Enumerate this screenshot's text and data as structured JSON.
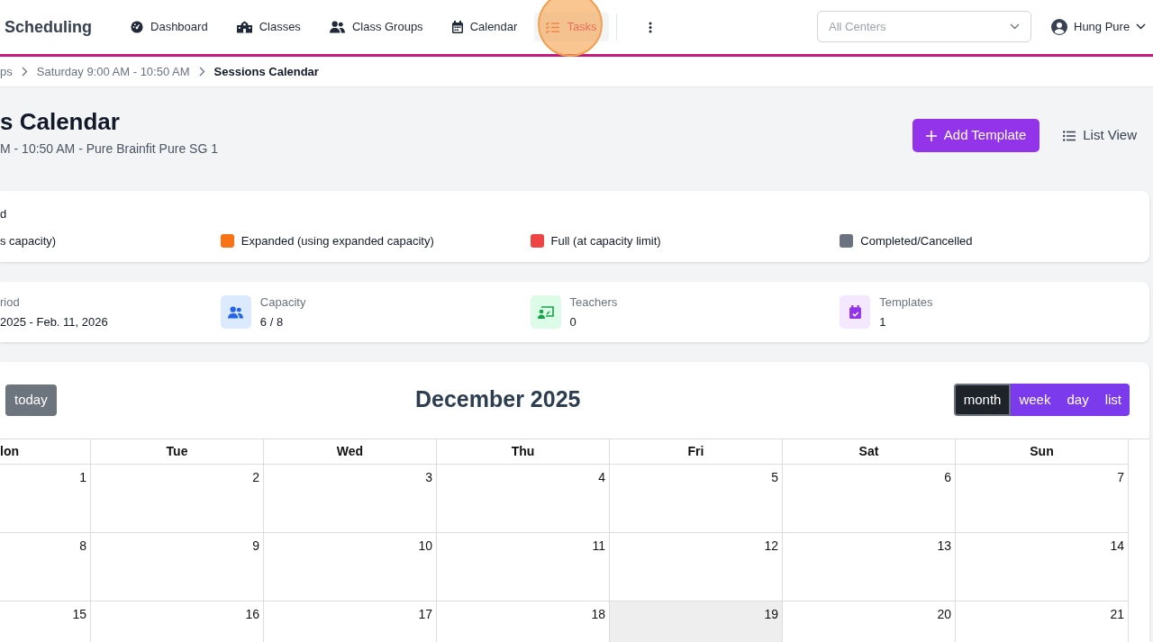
{
  "nav": {
    "brand": "Scheduling",
    "items": [
      {
        "label": "Dashboard",
        "selected": false
      },
      {
        "label": "Classes",
        "selected": false
      },
      {
        "label": "Class Groups",
        "selected": false
      },
      {
        "label": "Calendar",
        "selected": false
      },
      {
        "label": "Tasks",
        "selected": true
      }
    ],
    "center_select": {
      "placeholder": "All Centers"
    },
    "user": "Hung Pure"
  },
  "breadcrumb": [
    {
      "label": "ps",
      "current": false
    },
    {
      "label": "Saturday 9:00 AM - 10:50 AM",
      "current": false
    },
    {
      "label": "Sessions Calendar",
      "current": true
    }
  ],
  "header": {
    "title": "s Calendar",
    "subtitle": "M - 10:50 AM - Pure Brainfit Pure SG 1",
    "buttons": [
      {
        "label": "Add Template",
        "kind": "primary"
      },
      {
        "label": "List View",
        "kind": "link"
      }
    ]
  },
  "legend": {
    "title": "d",
    "items": [
      {
        "label": "s capacity)"
      },
      {
        "label": "Expanded (using expanded capacity)",
        "color": "#f97316"
      },
      {
        "label": "Full (at capacity limit)",
        "color": "#ef4444"
      },
      {
        "label": "Completed/Cancelled",
        "color": "#6b7280"
      }
    ]
  },
  "stats": [
    {
      "label": "riod",
      "value": "2025 - Feb. 11, 2026"
    },
    {
      "label": "Capacity",
      "value": "6 / 8"
    },
    {
      "label": "Teachers",
      "value": "0"
    },
    {
      "label": "Templates",
      "value": "1"
    }
  ],
  "calendar": {
    "today_button": "today",
    "title": "December 2025",
    "views": [
      {
        "label": "month",
        "selected": true
      },
      {
        "label": "week",
        "selected": false
      },
      {
        "label": "day",
        "selected": false
      },
      {
        "label": "list",
        "selected": false
      }
    ],
    "weekdays": [
      "lon",
      "Tue",
      "Wed",
      "Thu",
      "Fri",
      "Sat",
      "Sun"
    ],
    "weeks": [
      [
        {
          "day": "1",
          "today": false
        },
        {
          "day": "2",
          "today": false
        },
        {
          "day": "3",
          "today": false
        },
        {
          "day": "4",
          "today": false
        },
        {
          "day": "5",
          "today": false
        },
        {
          "day": "6",
          "today": false
        },
        {
          "day": "7",
          "today": false
        }
      ],
      [
        {
          "day": "8",
          "today": false
        },
        {
          "day": "9",
          "today": false
        },
        {
          "day": "10",
          "today": false
        },
        {
          "day": "11",
          "today": false
        },
        {
          "day": "12",
          "today": false
        },
        {
          "day": "13",
          "today": false
        },
        {
          "day": "14",
          "today": false
        }
      ],
      [
        {
          "day": "15",
          "today": false
        },
        {
          "day": "16",
          "today": false
        },
        {
          "day": "17",
          "today": false
        },
        {
          "day": "18",
          "today": false
        },
        {
          "day": "19",
          "today": true
        },
        {
          "day": "20",
          "today": false
        },
        {
          "day": "21",
          "today": false
        }
      ]
    ]
  }
}
